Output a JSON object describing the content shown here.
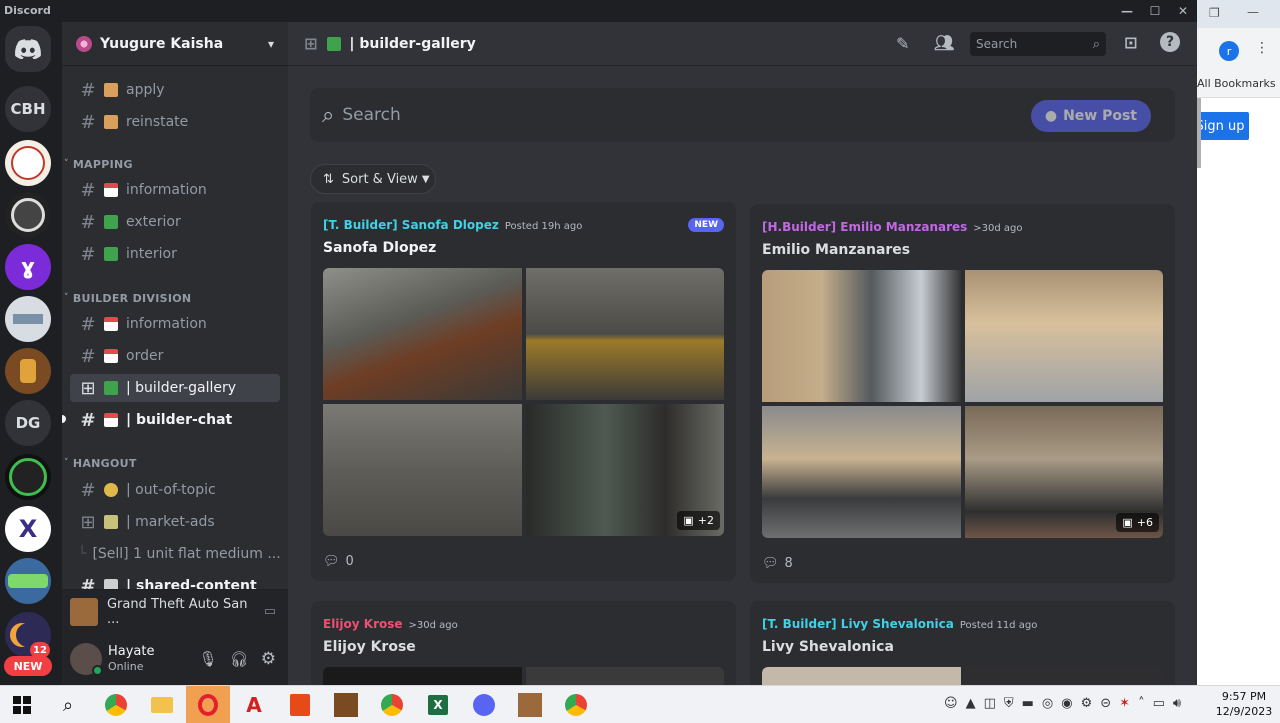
{
  "window": {
    "app_name": "Discord",
    "min": "—",
    "max": "☐",
    "close": "✕"
  },
  "rail": {
    "servers": [
      {
        "label": "",
        "name": "discord-home"
      },
      {
        "label": "CBH",
        "name": "server-cbh"
      },
      {
        "label": "",
        "name": "server-jonas-rental"
      },
      {
        "label": "",
        "name": "server-fist"
      },
      {
        "label": "",
        "name": "server-purple"
      },
      {
        "label": "",
        "name": "server-company"
      },
      {
        "label": "",
        "name": "server-avatar"
      },
      {
        "label": "DG",
        "name": "server-dg"
      },
      {
        "label": "",
        "name": "server-green"
      },
      {
        "label": "",
        "name": "server-excellent"
      },
      {
        "label": "",
        "name": "server-vtx"
      },
      {
        "label": "",
        "name": "server-last"
      }
    ],
    "badge_count": "12",
    "new_label": "NEW"
  },
  "guild": {
    "name": "Yuugure Kaisha",
    "chevron": "⌄"
  },
  "channels": {
    "top": [
      {
        "name": "apply",
        "emoji_color": "#d9a05b"
      },
      {
        "name": "reinstate",
        "emoji_color": "#d9a05b"
      }
    ],
    "cat_mapping": "MAPPING",
    "mapping": [
      {
        "name": "information",
        "emoji_color": "#d94f4f"
      },
      {
        "name": "exterior",
        "emoji_color": "#3fa34d"
      },
      {
        "name": "interior",
        "emoji_color": "#3fa34d"
      }
    ],
    "cat_builder": "BUILDER DIVISION",
    "builder": [
      {
        "name": "information",
        "emoji_color": "#d94f4f"
      },
      {
        "name": "order",
        "emoji_color": "#d94f4f"
      },
      {
        "name": "| builder-gallery",
        "emoji_color": "#3fa34d"
      },
      {
        "name": "| builder-chat",
        "emoji_color": "#d94f4f"
      }
    ],
    "cat_hangout": "HANGOUT",
    "hangout": [
      {
        "name": "| out-of-topic",
        "emoji_color": "#e0b84a"
      },
      {
        "name": "| market-ads",
        "emoji_color": "#c7c27a"
      },
      {
        "name": "[Sell] 1 unit flat medium ...",
        "emoji_color": ""
      },
      {
        "name": "| shared-content",
        "emoji_color": "#cfcfcf"
      }
    ]
  },
  "voice": {
    "activity": "Grand Theft Auto San ..."
  },
  "user": {
    "name": "Hayate",
    "status": "Online"
  },
  "header": {
    "channel": "| builder-gallery",
    "search_placeholder": "Search"
  },
  "forum": {
    "search_placeholder": "Search",
    "new_post": "New Post",
    "sort_label": "Sort & View",
    "posts": [
      {
        "author": "[T. Builder] Sanofa Dlopez",
        "author_color": "#3fd1e6",
        "posted": "Posted 19h ago",
        "title": "Sanofa Dlopez",
        "badge": "NEW",
        "more": "+2",
        "comments": "0"
      },
      {
        "author": "[H.Builder] Emilio Manzanares",
        "author_color": "#c267e6",
        "posted": ">30d ago",
        "title": "Emilio Manzanares",
        "badge": "",
        "more": "+6",
        "comments": "8"
      },
      {
        "author": "Elijoy Krose",
        "author_color": "#ef4f70",
        "posted": ">30d ago",
        "title": "Elijoy Krose",
        "badge": "",
        "more": "",
        "comments": ""
      },
      {
        "author": "[T. Builder] Livy Shevalonica",
        "author_color": "#3fd1e6",
        "posted": "Posted 11d ago",
        "title": "Livy Shevalonica",
        "badge": "",
        "more": "",
        "comments": ""
      }
    ]
  },
  "browser": {
    "bookmarks": "All Bookmarks",
    "signup": "Sign up",
    "profile": "r"
  },
  "taskbar": {
    "time": "9:57 PM",
    "date": "12/9/2023"
  }
}
